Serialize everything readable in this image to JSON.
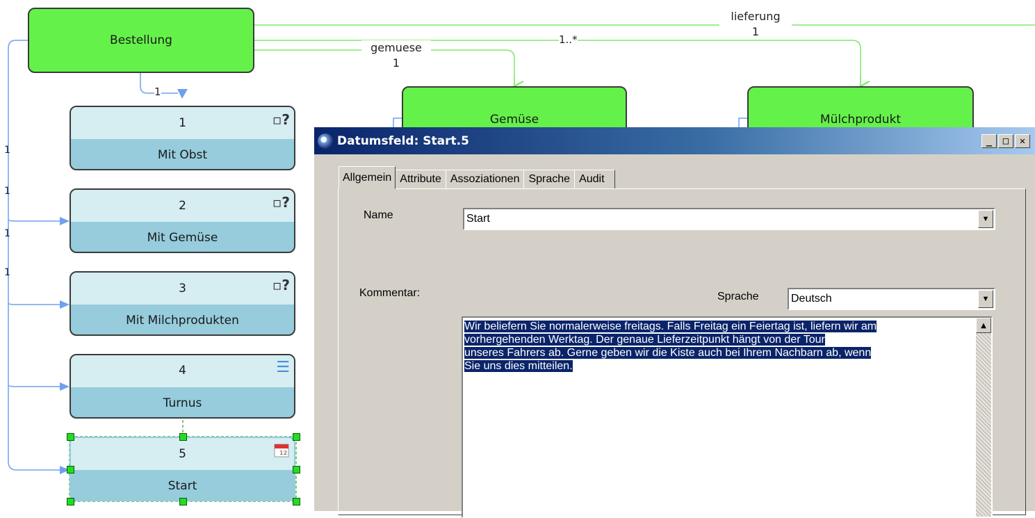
{
  "diagram": {
    "nodes": {
      "bestellung": "Bestellung",
      "gemuese": "Gemüse",
      "muelchprodukt": "Mülchprodukt"
    },
    "edges": {
      "lieferung_label": "lieferung",
      "lieferung_mult": "1",
      "gemuese_label": "gemuese",
      "gemuese_mult": "1",
      "milch_mult": "1..*",
      "sub_mult": "1",
      "left_mults": [
        "1",
        "1",
        "1",
        "1"
      ]
    },
    "subnodes": [
      {
        "number": "1",
        "label": "Mit Obst",
        "icon": "unknown-type-icon"
      },
      {
        "number": "2",
        "label": "Mit Gemüse",
        "icon": "unknown-type-icon"
      },
      {
        "number": "3",
        "label": "Mit Milchprodukten",
        "icon": "unknown-type-icon"
      },
      {
        "number": "4",
        "label": "Turnus",
        "icon": "list-icon"
      },
      {
        "number": "5",
        "label": "Start",
        "icon": "calendar-icon"
      }
    ]
  },
  "dialog": {
    "title": "Datumsfeld: Start.5",
    "tabs": [
      "Allgemein",
      "Attribute",
      "Assoziationen",
      "Sprache",
      "Audit"
    ],
    "active_tab": "Allgemein",
    "name_label": "Name",
    "name_value": "Start",
    "comment_label": "Kommentar:",
    "language_label": "Sprache",
    "language_value": "Deutsch",
    "comment_lines": [
      "Wir beliefern Sie normalerweise freitags. Falls Freitag ein Feiertag ist, liefern wir am",
      "vorhergehenden Werktag. Der genaue Lieferzeitpunkt hängt von der Tour",
      "unseres Fahrers ab. Gerne geben wir die Kiste auch bei Ihrem Nachbarn ab, wenn",
      "Sie uns dies mitteilen."
    ]
  },
  "colors": {
    "entity_green": "#64f24a",
    "subnode_light": "#d6edf2",
    "subnode_dark": "#96ccdc",
    "edge_green": "#7ee86a",
    "edge_blue": "#6fa0f0",
    "selection_text_bg": "#0a246a"
  }
}
